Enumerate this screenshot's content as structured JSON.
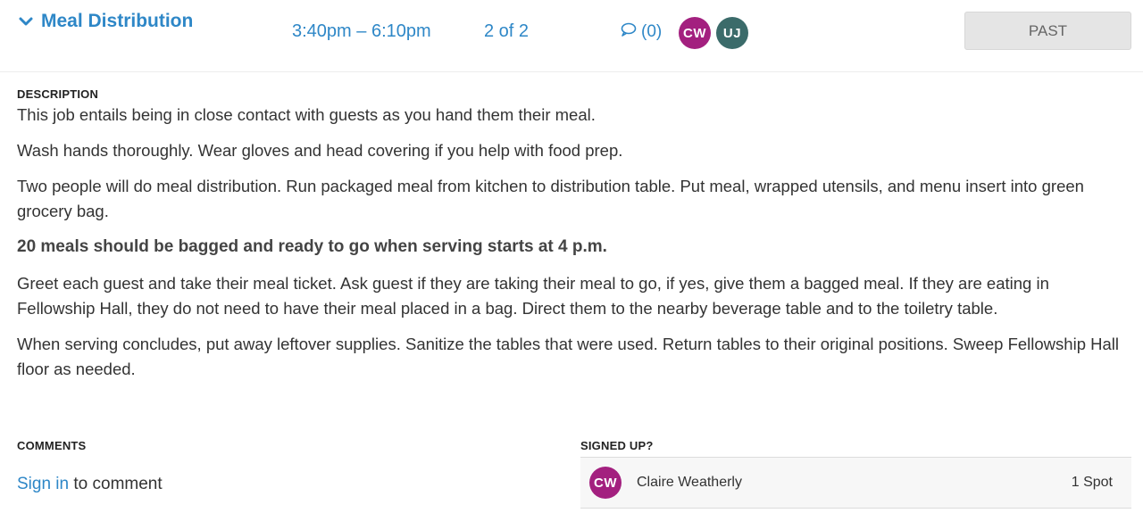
{
  "header": {
    "title": "Meal Distribution",
    "time_range": "3:40pm – 6:10pm",
    "slot_count": "2 of 2",
    "comments_count": "(0)",
    "avatars": [
      {
        "initials": "CW",
        "color": "#a3207f"
      },
      {
        "initials": "UJ",
        "color": "#3b6b6a"
      }
    ],
    "status_button": "PAST"
  },
  "description": {
    "label": "DESCRIPTION",
    "paragraphs": [
      "This job entails being in close contact with guests as you hand them their meal.",
      "Wash hands thoroughly. Wear gloves and head covering if you help with food prep.",
      "Two people will do meal distribution. Run packaged meal from kitchen to distribution table. Put meal, wrapped utensils, and menu insert into green grocery bag.",
      "20 meals should be bagged and ready to go when serving starts at 4 p.m.",
      "Greet each guest and take their meal ticket. Ask guest if they are taking their meal to go, if yes, give them a bagged meal. If they are eating in Fellowship Hall, they do not need to have their meal placed in a bag. Direct them to the nearby beverage table and to the toiletry table.",
      "When serving concludes, put away leftover supplies. Sanitize the tables that were used. Return tables to their original positions. Sweep Fellowship Hall floor as needed."
    ]
  },
  "comments": {
    "label": "COMMENTS",
    "sign_in_link": "Sign in",
    "sign_in_suffix": " to comment"
  },
  "signed_up": {
    "label": "SIGNED UP?",
    "entries": [
      {
        "initials": "CW",
        "name": "Claire Weatherly",
        "spots": "1 Spot",
        "color": "#a3207f"
      }
    ]
  },
  "colors": {
    "link": "#2e87c7",
    "avatar_cw": "#a3207f",
    "avatar_uj": "#3b6b6a",
    "past_button_bg": "#e5e5e5"
  },
  "icons": {
    "title_toggle": "chevron-down-icon",
    "comments": "speech-bubble-icon"
  }
}
